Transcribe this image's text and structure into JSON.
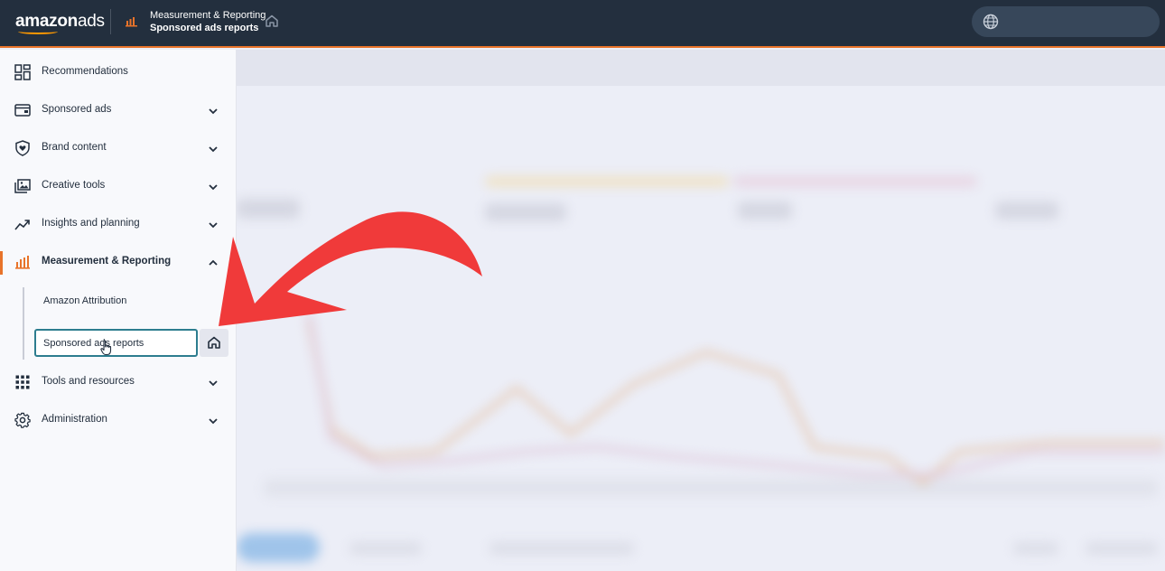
{
  "app": {
    "logo_primary": "amazon",
    "logo_secondary": "ads"
  },
  "topbar": {
    "breadcrumb_parent": "Measurement & Reporting",
    "breadcrumb_current": "Sponsored ads reports",
    "icons": [
      "bar-chart-icon",
      "home-icon",
      "globe-icon"
    ]
  },
  "sidebar": {
    "items": [
      {
        "label": "Recommendations",
        "icon": "dashboard-icon",
        "expandable": false
      },
      {
        "label": "Sponsored ads",
        "icon": "wallet-icon",
        "expandable": true
      },
      {
        "label": "Brand content",
        "icon": "shield-heart-icon",
        "expandable": true
      },
      {
        "label": "Creative tools",
        "icon": "images-icon",
        "expandable": true
      },
      {
        "label": "Insights and planning",
        "icon": "trend-icon",
        "expandable": true
      },
      {
        "label": "Measurement & Reporting",
        "icon": "bar-chart-icon",
        "expandable": true,
        "expanded": true,
        "active": true
      },
      {
        "label": "Tools and resources",
        "icon": "grid-icon",
        "expandable": true
      },
      {
        "label": "Administration",
        "icon": "gear-icon",
        "expandable": true
      }
    ],
    "sub_items": [
      {
        "label": "Amazon Attribution"
      },
      {
        "label": "Sponsored ads reports",
        "selected": true
      }
    ]
  },
  "colors": {
    "topbar": "#232f3e",
    "accent": "#e8732a",
    "selected_border": "#2d7d8f",
    "annotation_arrow": "#f03a3a"
  }
}
